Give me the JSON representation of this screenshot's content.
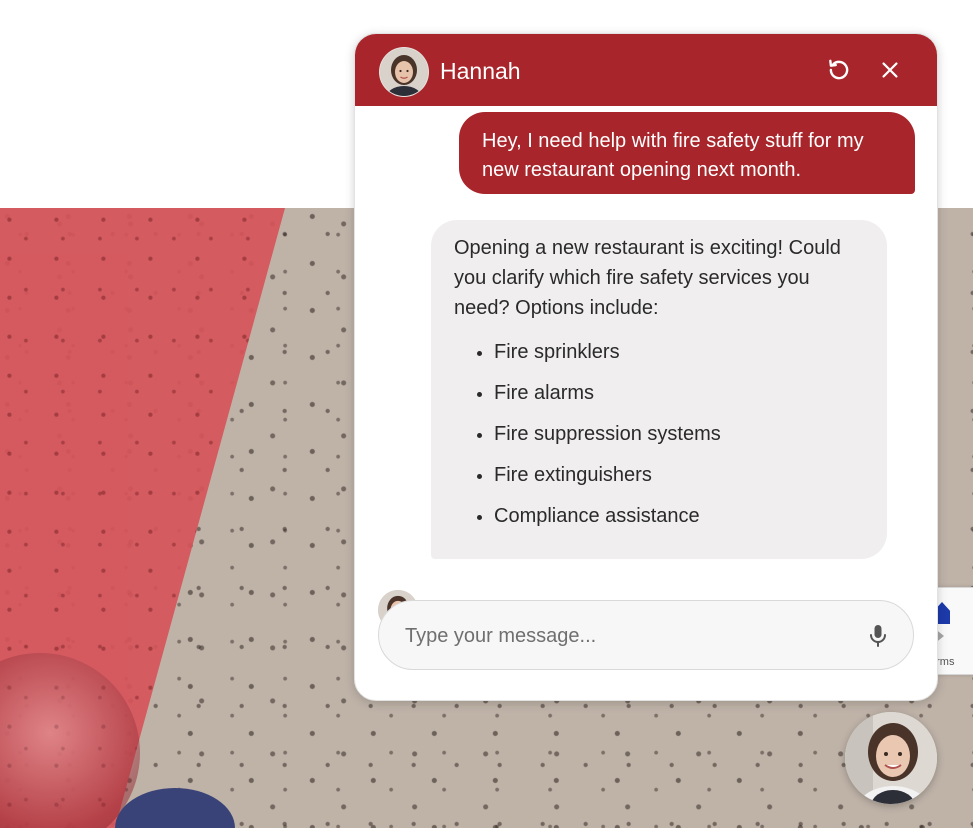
{
  "chat": {
    "agent_name": "Hannah",
    "restart_icon": "restart-icon",
    "close_icon": "close-icon",
    "header_color": "#a8262b",
    "messages": {
      "user": "Hey, I need help with fire safety stuff for my new restaurant opening next month.",
      "bot_intro": "Opening a new restaurant is exciting! Could you clarify which fire safety services you need? Options include:",
      "bot_options": [
        "Fire sprinklers",
        "Fire alarms",
        "Fire suppression systems",
        "Fire extinguishers",
        "Compliance assistance"
      ]
    },
    "composer": {
      "placeholder": "Type your message...",
      "mic_icon": "microphone-icon"
    }
  },
  "recaptcha": {
    "terms_text": "erms"
  }
}
